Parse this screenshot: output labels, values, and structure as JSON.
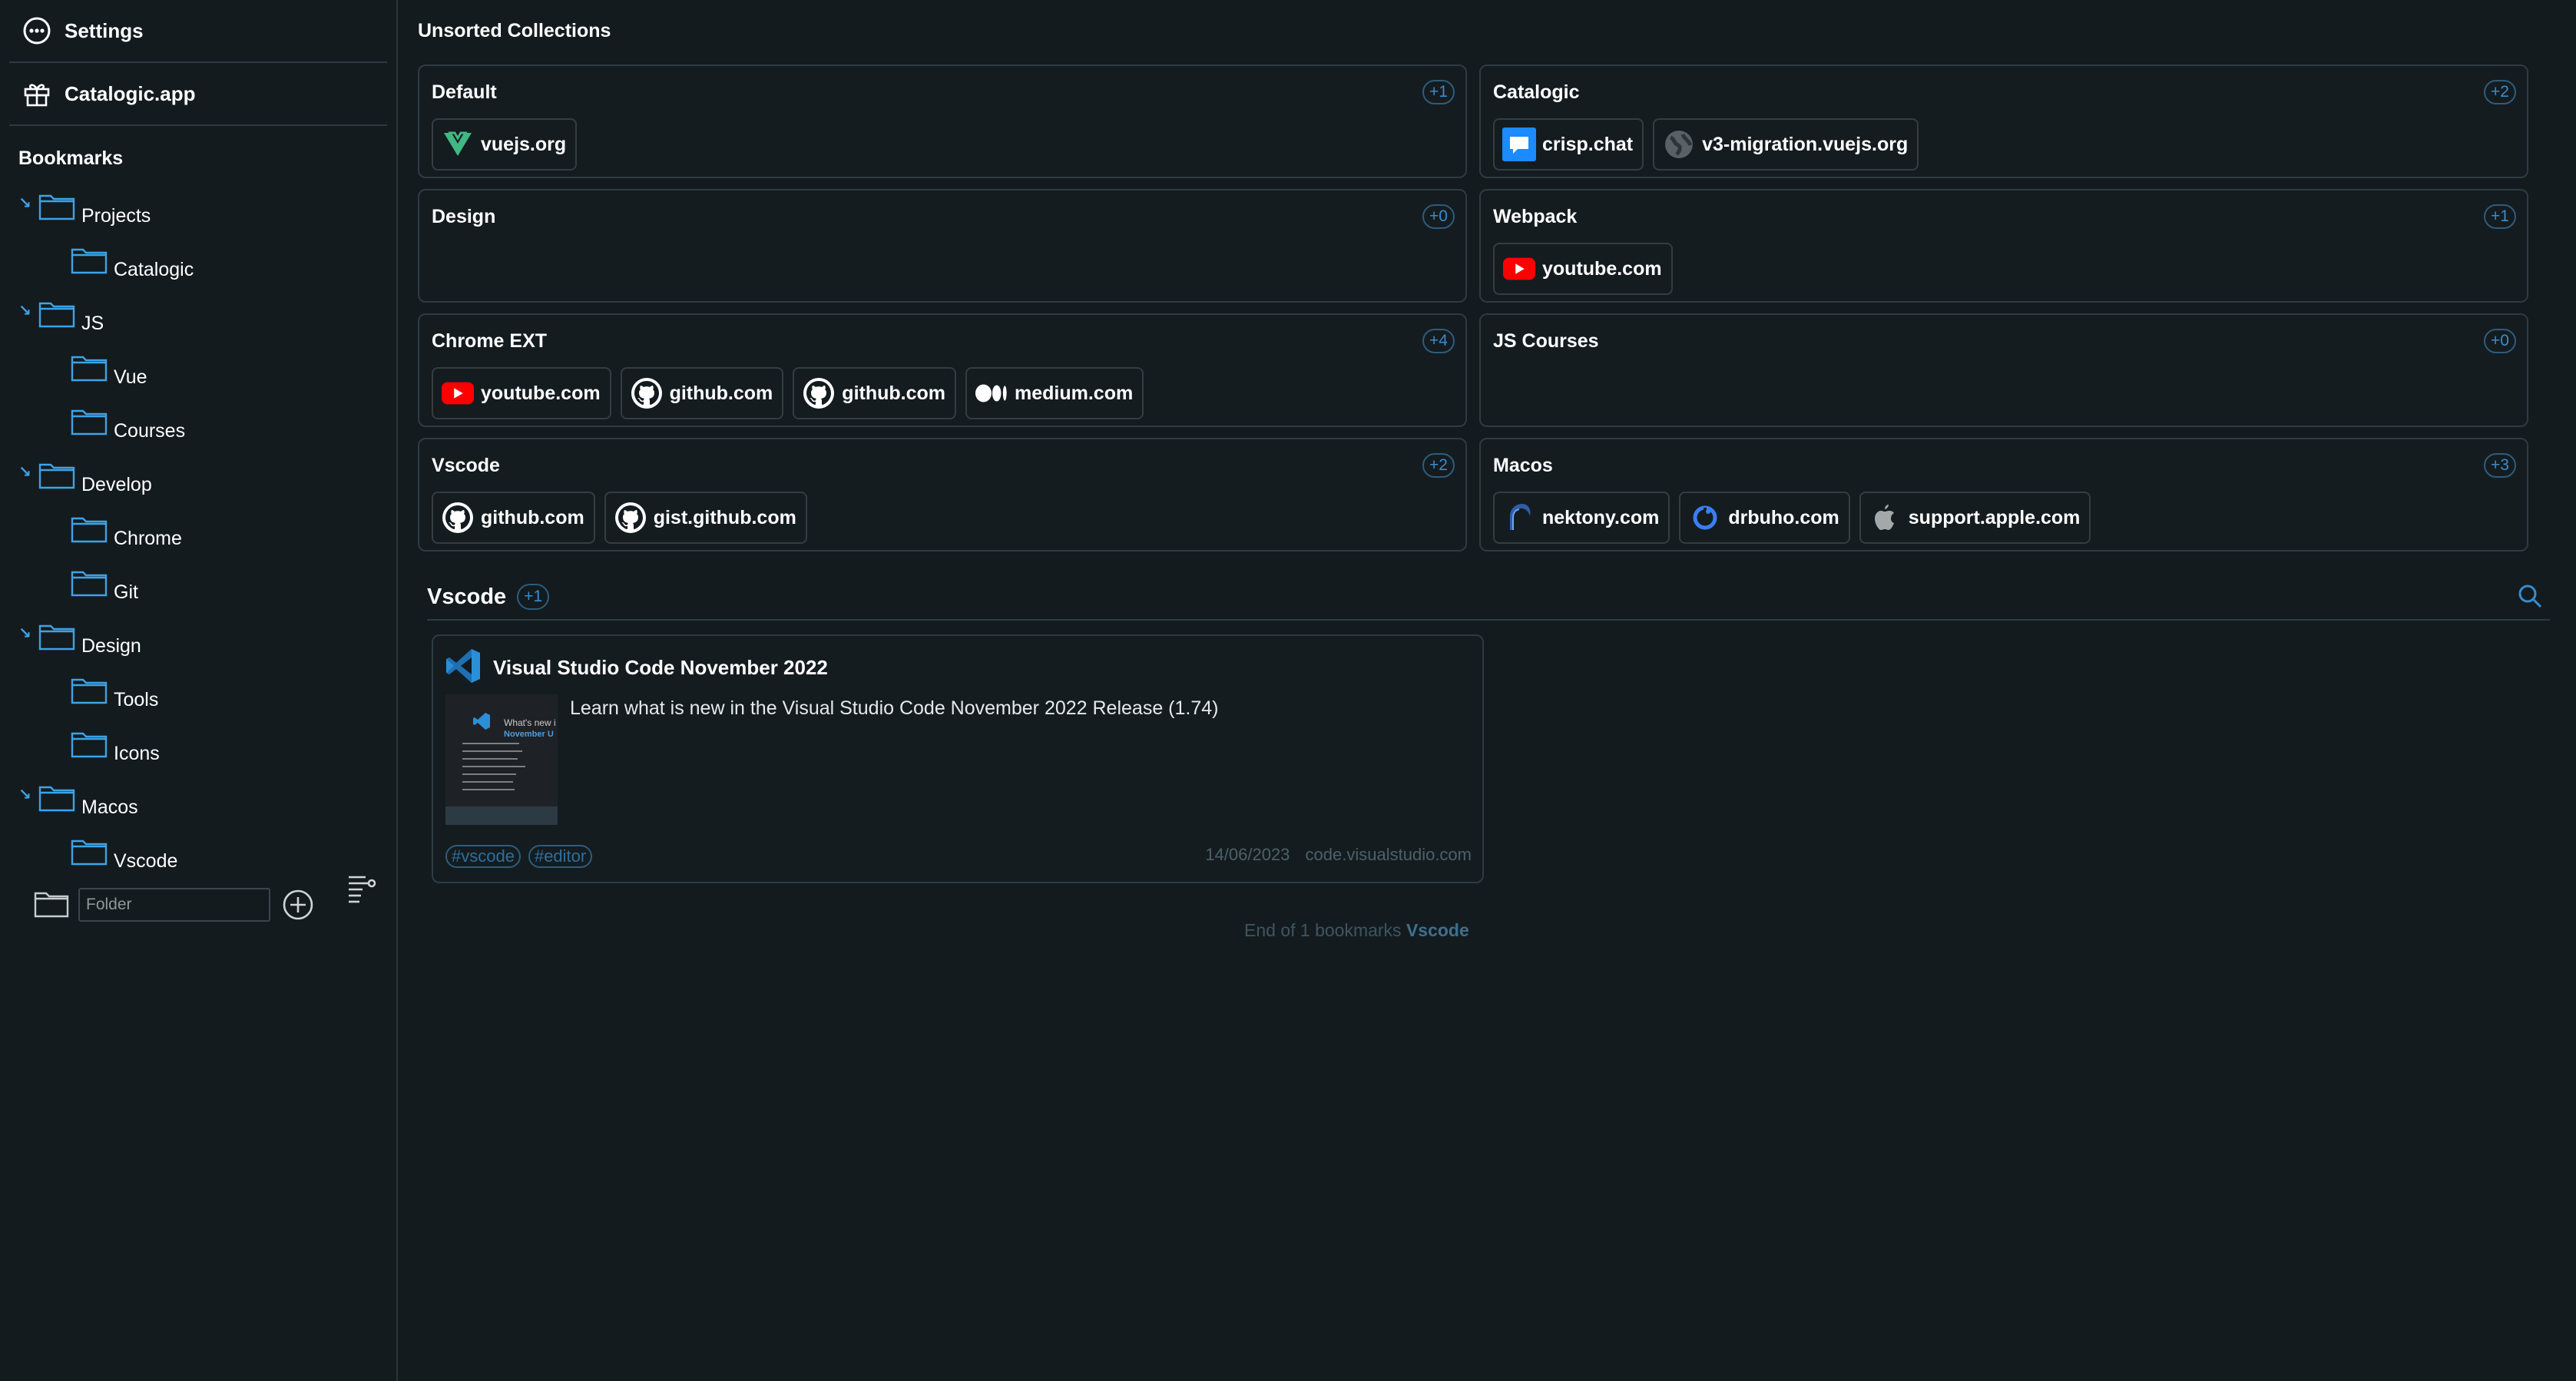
{
  "sidebar": {
    "settings_label": "Settings",
    "app_label": "Catalogic.app",
    "bookmarks_title": "Bookmarks",
    "tree": [
      {
        "label": "Projects",
        "level": 0
      },
      {
        "label": "Catalogic",
        "level": 1
      },
      {
        "label": "JS",
        "level": 0
      },
      {
        "label": "Vue",
        "level": 1
      },
      {
        "label": "Courses",
        "level": 1
      },
      {
        "label": "Develop",
        "level": 0
      },
      {
        "label": "Chrome",
        "level": 1
      },
      {
        "label": "Git",
        "level": 1
      },
      {
        "label": "Design",
        "level": 0
      },
      {
        "label": "Tools",
        "level": 1
      },
      {
        "label": "Icons",
        "level": 1
      },
      {
        "label": "Macos",
        "level": 0
      },
      {
        "label": "Vscode",
        "level": 1
      }
    ],
    "folder_placeholder": "Folder"
  },
  "main": {
    "title": "Unsorted Collections",
    "collections": [
      {
        "title": "Default",
        "count": "+1",
        "chips": [
          {
            "label": "vuejs.org",
            "icon": "vue-icon"
          }
        ]
      },
      {
        "title": "Catalogic",
        "count": "+2",
        "chips": [
          {
            "label": "crisp.chat",
            "icon": "crisp-icon"
          },
          {
            "label": "v3-migration.vuejs.org",
            "icon": "globe-icon"
          }
        ]
      },
      {
        "title": "Design",
        "count": "+0",
        "chips": []
      },
      {
        "title": "Webpack",
        "count": "+1",
        "chips": [
          {
            "label": "youtube.com",
            "icon": "youtube-icon"
          }
        ]
      },
      {
        "title": "Chrome EXT",
        "count": "+4",
        "chips": [
          {
            "label": "youtube.com",
            "icon": "youtube-icon"
          },
          {
            "label": "github.com",
            "icon": "github-icon"
          },
          {
            "label": "github.com",
            "icon": "github-icon"
          },
          {
            "label": "medium.com",
            "icon": "medium-icon"
          }
        ]
      },
      {
        "title": "JS Courses",
        "count": "+0",
        "chips": []
      },
      {
        "title": "Vscode",
        "count": "+2",
        "chips": [
          {
            "label": "github.com",
            "icon": "github-icon"
          },
          {
            "label": "gist.github.com",
            "icon": "github-icon"
          }
        ]
      },
      {
        "title": "Macos",
        "count": "+3",
        "chips": [
          {
            "label": "nektony.com",
            "icon": "nektony-icon"
          },
          {
            "label": "drbuho.com",
            "icon": "drbuho-icon"
          },
          {
            "label": "support.apple.com",
            "icon": "apple-icon"
          }
        ]
      }
    ],
    "section": {
      "title": "Vscode",
      "count": "+1"
    },
    "bookmark": {
      "title": "Visual Studio Code November 2022",
      "description": "Learn what is new in the Visual Studio Code November 2022 Release (1.74)",
      "thumb_heading": "What's new i",
      "thumb_subheading": "November U",
      "tags": [
        "#vscode",
        "#editor"
      ],
      "date": "14/06/2023",
      "domain": "code.visualstudio.com"
    },
    "end_note_prefix": "End of 1 bookmarks",
    "end_note_collection": "Vscode"
  },
  "colors": {
    "background": "#131b1f",
    "accent": "#3a8ccc",
    "folder": "#3da3e6"
  }
}
